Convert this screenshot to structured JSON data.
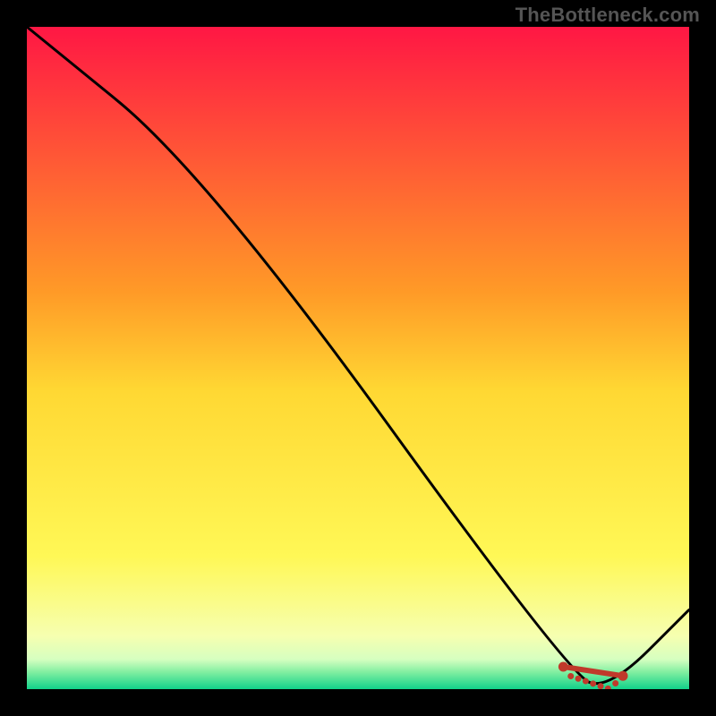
{
  "watermark": "TheBottleneck.com",
  "chart_data": {
    "type": "line",
    "title": "",
    "xlabel": "",
    "ylabel": "",
    "xlim": [
      0,
      100
    ],
    "ylim": [
      0,
      100
    ],
    "x": [
      0,
      27,
      82,
      88,
      100
    ],
    "values": [
      100,
      78,
      2,
      0,
      12
    ],
    "marker_range_x": [
      81,
      90
    ],
    "gradient_stops": [
      {
        "pos": 0.0,
        "color": "#ff1744"
      },
      {
        "pos": 0.4,
        "color": "#ff9a27"
      },
      {
        "pos": 0.55,
        "color": "#ffd833"
      },
      {
        "pos": 0.8,
        "color": "#fff856"
      },
      {
        "pos": 0.92,
        "color": "#f6ffb0"
      },
      {
        "pos": 0.955,
        "color": "#d6ffc0"
      },
      {
        "pos": 0.975,
        "color": "#7eeea0"
      },
      {
        "pos": 1.0,
        "color": "#11d18a"
      }
    ],
    "line_color": "#000000",
    "marker_color": "#c0392b"
  }
}
